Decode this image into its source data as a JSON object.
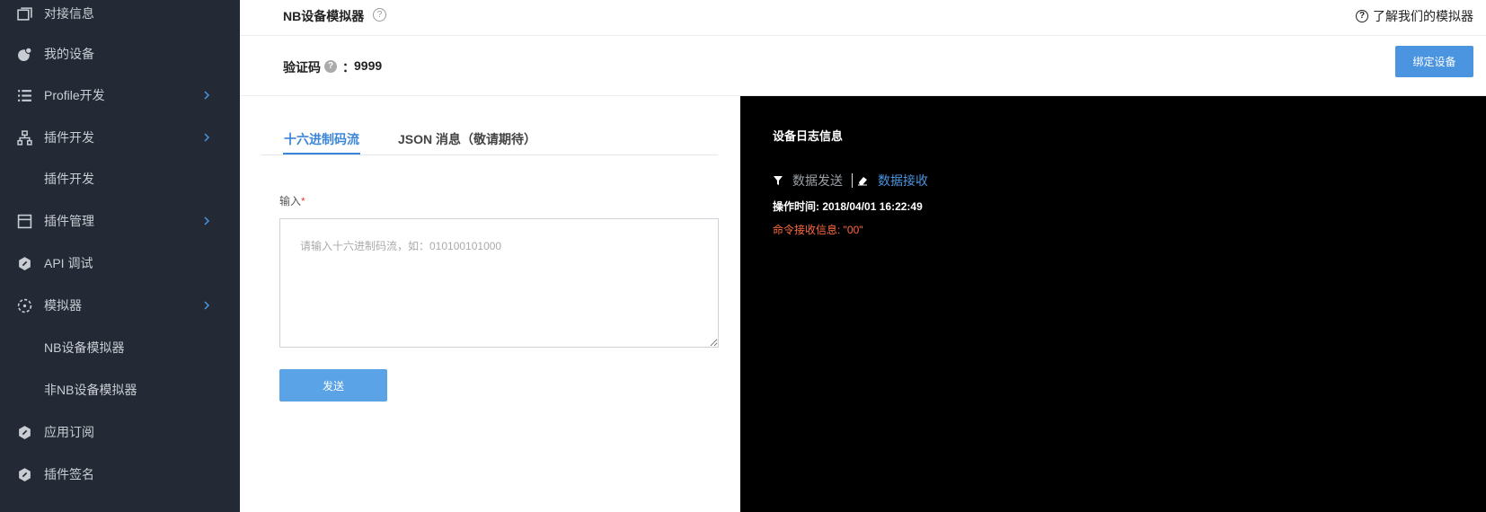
{
  "sidebar": {
    "items": [
      {
        "label": "对接信息",
        "icon": "window-icon",
        "has_chevron": false
      },
      {
        "label": "我的设备",
        "icon": "device-icon",
        "has_chevron": false
      },
      {
        "label": "Profile开发",
        "icon": "list-icon",
        "has_chevron": true
      },
      {
        "label": "插件开发",
        "icon": "hierarchy-icon",
        "has_chevron": true
      },
      {
        "label": "插件开发",
        "icon": "",
        "has_chevron": false
      },
      {
        "label": "插件管理",
        "icon": "panel-icon",
        "has_chevron": true
      },
      {
        "label": "API 调试",
        "icon": "hex-icon",
        "has_chevron": false
      },
      {
        "label": "模拟器",
        "icon": "dotted-circle-icon",
        "has_chevron": true
      },
      {
        "label": "NB设备模拟器",
        "icon": "",
        "has_chevron": false
      },
      {
        "label": "非NB设备模拟器",
        "icon": "",
        "has_chevron": false
      },
      {
        "label": "应用订阅",
        "icon": "hex-icon",
        "has_chevron": false
      },
      {
        "label": "插件签名",
        "icon": "hex-icon",
        "has_chevron": false
      }
    ],
    "colors": {
      "background": "#232a35",
      "text": "#c9cdd3",
      "chevron": "#4b94e0"
    }
  },
  "header": {
    "title": "NB设备模拟器",
    "help_icon": "question-circle-icon",
    "learn_link": "了解我们的模拟器"
  },
  "verify": {
    "label": "验证码",
    "colon": "：",
    "code": "9999",
    "bind_button": "绑定设备"
  },
  "tabs": [
    {
      "label": "十六进制码流",
      "active": true
    },
    {
      "label": "JSON 消息（敬请期待）",
      "active": false
    }
  ],
  "form": {
    "input_label": "输入",
    "required_mark": "*",
    "placeholder": "请输入十六进制码流，如：010100101000",
    "value": "",
    "send_button": "发送"
  },
  "log": {
    "title": "设备日志信息",
    "filter_send": "数据发送",
    "filter_receive": "数据接收",
    "active_filter": "数据接收",
    "time_line": "操作时间: 2018/04/01 16:22:49",
    "command_line": "命令接收信息: \"00\""
  },
  "colors": {
    "accent": "#4b94e0",
    "log_background": "#000000",
    "command_text": "#ff6a3d"
  }
}
